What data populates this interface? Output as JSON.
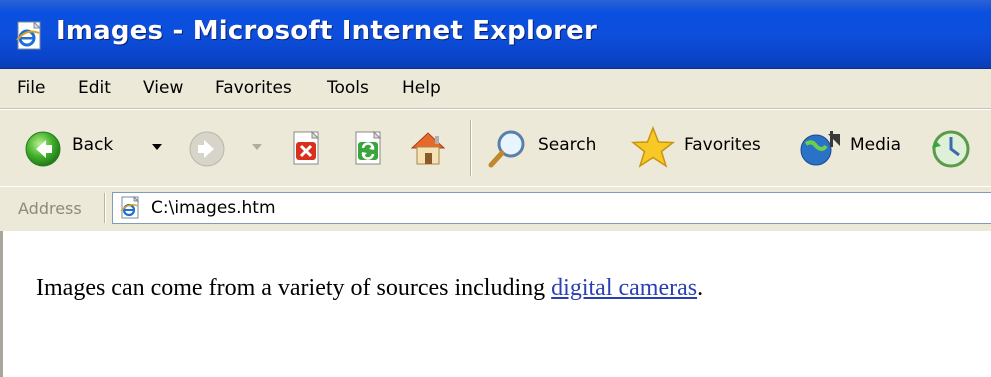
{
  "window": {
    "title": "Images - Microsoft Internet Explorer",
    "icon": "ie-page-icon"
  },
  "menu": {
    "items": [
      "File",
      "Edit",
      "View",
      "Favorites",
      "Tools",
      "Help"
    ]
  },
  "toolbar": {
    "back_label": "Back",
    "search_label": "Search",
    "favorites_label": "Favorites",
    "media_label": "Media",
    "icons": [
      "back-icon",
      "forward-icon",
      "stop-icon",
      "refresh-icon",
      "home-icon",
      "search-icon",
      "favorites-icon",
      "media-icon",
      "history-icon"
    ]
  },
  "address": {
    "label": "Address",
    "value": "C:\\images.htm",
    "icon": "ie-page-icon"
  },
  "content": {
    "text_before_link": "Images can come from a variety of sources including ",
    "link_text": "digital cameras",
    "text_after_link": "."
  },
  "colors": {
    "titlebar": "#0d4fdc",
    "chrome": "#ece9d8",
    "link": "#2a3fb2"
  }
}
